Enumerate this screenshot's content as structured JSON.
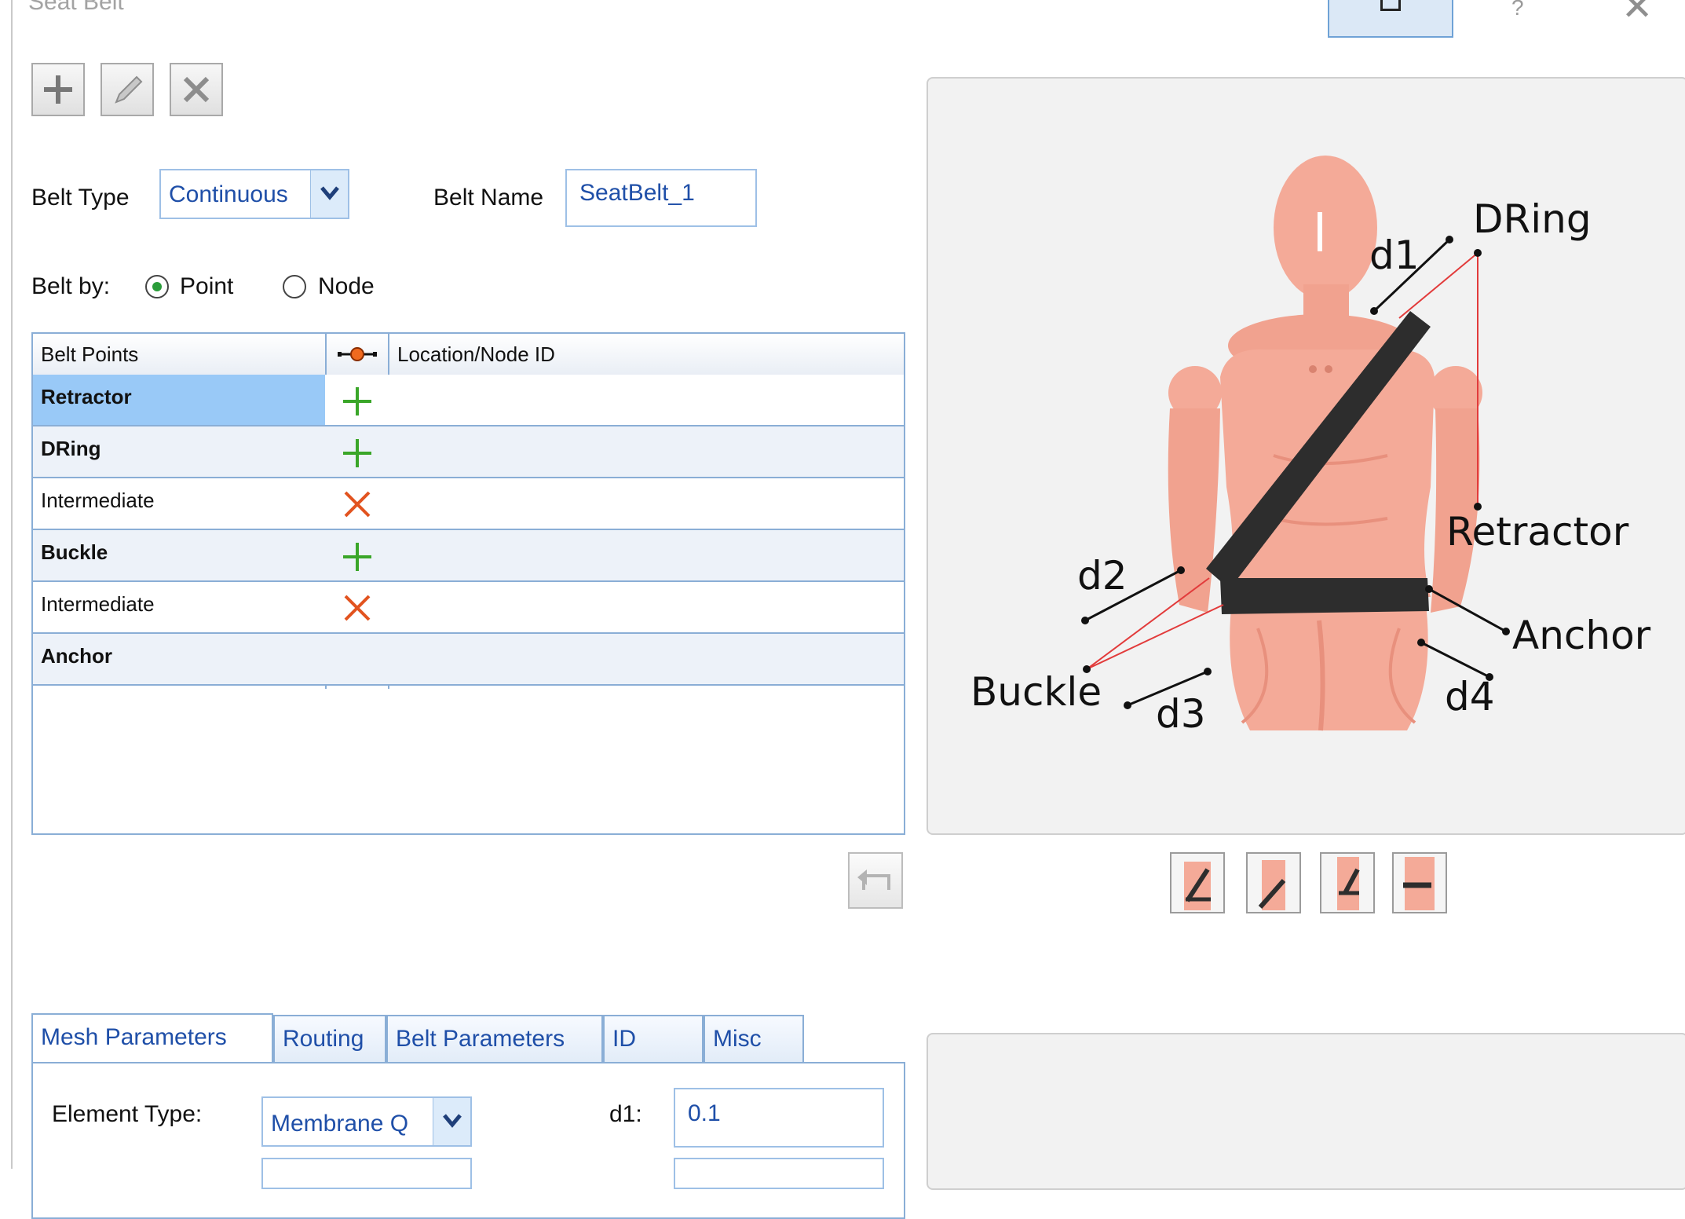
{
  "window": {
    "title": "Seat Belt",
    "help_label": "?",
    "close_label": "✕",
    "icons": [
      "restore-icon",
      "help-icon",
      "close-icon"
    ]
  },
  "toolbar": {
    "icons": [
      "add-icon",
      "edit-pencil-icon",
      "delete-x-icon"
    ]
  },
  "form": {
    "belt_type_label": "Belt Type",
    "belt_type_value": "Continuous",
    "belt_name_label": "Belt Name",
    "belt_name_value": "SeatBelt_1",
    "belt_by_label": "Belt by:",
    "belt_by_options": [
      "Point",
      "Node"
    ],
    "belt_by_selected": "Point"
  },
  "grid": {
    "columns": [
      "Belt Points",
      "",
      "Location/Node ID"
    ],
    "rows": [
      {
        "name": "Retractor",
        "bold": true,
        "status": "plus",
        "location": "",
        "selected": true
      },
      {
        "name": "DRing",
        "bold": true,
        "status": "plus",
        "location": ""
      },
      {
        "name": "Intermediate",
        "bold": false,
        "status": "x",
        "location": ""
      },
      {
        "name": "Buckle",
        "bold": true,
        "status": "plus",
        "location": ""
      },
      {
        "name": "Intermediate",
        "bold": false,
        "status": "x",
        "location": ""
      },
      {
        "name": "Anchor",
        "bold": true,
        "status": "",
        "location": ""
      }
    ]
  },
  "diagram": {
    "labels": {
      "dring": "DRing",
      "retractor": "Retractor",
      "anchor": "Anchor",
      "buckle": "Buckle",
      "d1": "d1",
      "d2": "d2",
      "d3": "d3",
      "d4": "d4"
    },
    "colors": {
      "skin": "#f4aa98",
      "skin_dark": "#e8907d",
      "belt": "#2d2d2d",
      "guide_line": "#e23b3b"
    }
  },
  "thumbnails": [
    "view-1",
    "view-2",
    "view-3",
    "view-4"
  ],
  "tabs": {
    "items": [
      "Mesh Parameters",
      "Routing",
      "Belt Parameters",
      "ID",
      "Misc"
    ],
    "active": "Mesh Parameters"
  },
  "mesh": {
    "element_type_label": "Element Type:",
    "element_type_value": "Membrane Q",
    "d1_label": "d1:",
    "d1_value": "0.1"
  },
  "colors": {
    "accent": "#1f4fa8",
    "border": "#8aaed6",
    "selected_row": "#99c9f7",
    "ok_green": "#3aa629",
    "err_orange": "#e2531f"
  }
}
